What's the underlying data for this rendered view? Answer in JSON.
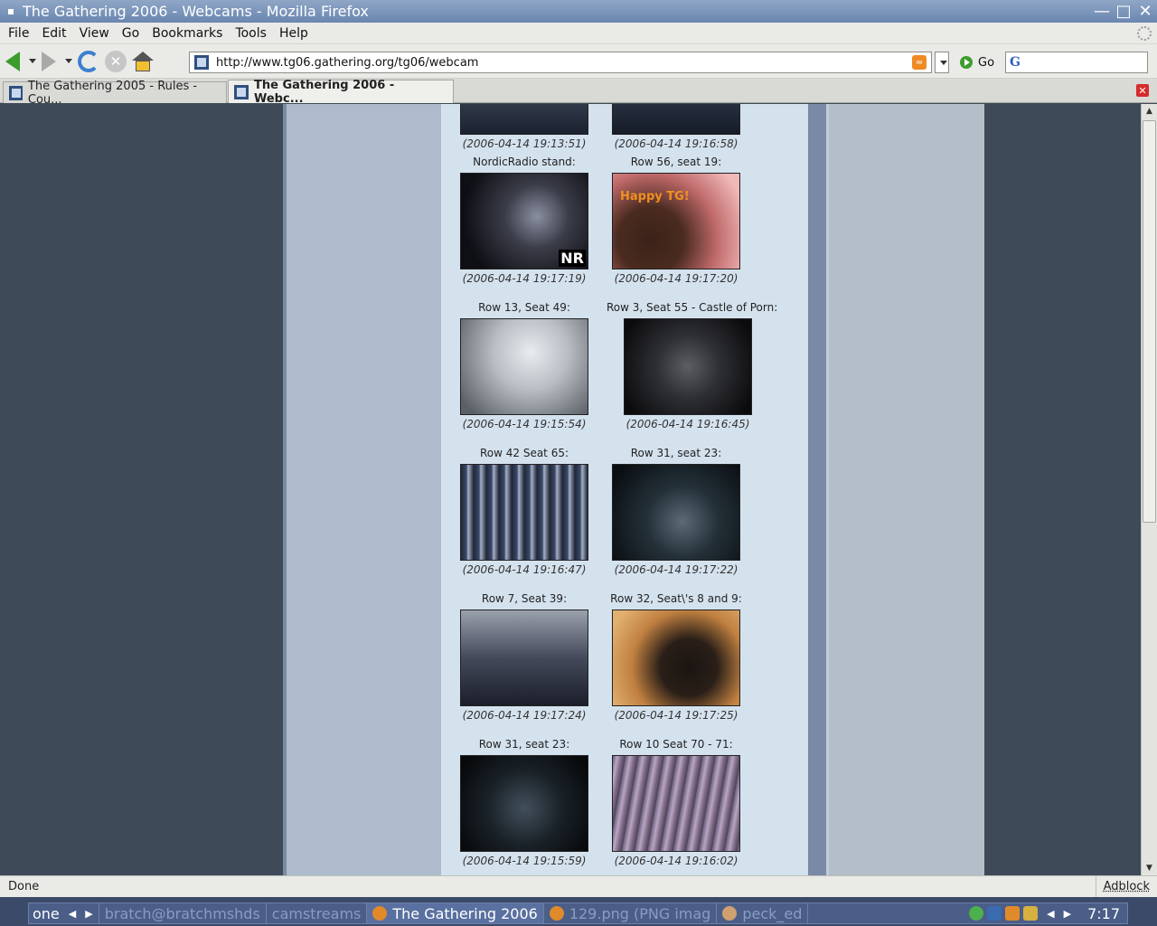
{
  "window": {
    "title": "The Gathering 2006 - Webcams - Mozilla Firefox"
  },
  "menu": [
    "File",
    "Edit",
    "View",
    "Go",
    "Bookmarks",
    "Tools",
    "Help"
  ],
  "navbar": {
    "url": "http://www.tg06.gathering.org/tg06/webcam",
    "go_label": "Go"
  },
  "tabs": [
    {
      "label": "The Gathering 2005 - Rules - Cou...",
      "active": false
    },
    {
      "label": "The Gathering 2006 - Webc...",
      "active": true
    }
  ],
  "cams_top": [
    {
      "timestamp": "(2006-04-14 19:13:51)"
    },
    {
      "timestamp": "(2006-04-14 19:16:58)"
    }
  ],
  "cams": [
    {
      "caption": "NordicRadio stand:",
      "timestamp": "(2006-04-14 19:17:19)",
      "overlay": "NR"
    },
    {
      "caption": "Row 56, seat 19:",
      "timestamp": "(2006-04-14 19:17:20)",
      "overlay": "Happy TG!"
    },
    {
      "caption": "Row 13, Seat 49:",
      "timestamp": "(2006-04-14 19:15:54)"
    },
    {
      "caption": "Row 3, Seat 55 - Castle of Porn:",
      "timestamp": "(2006-04-14 19:16:45)"
    },
    {
      "caption": "Row 42 Seat 65:",
      "timestamp": "(2006-04-14 19:16:47)"
    },
    {
      "caption": "Row 31, seat 23:",
      "timestamp": "(2006-04-14 19:17:22)"
    },
    {
      "caption": "Row 7, Seat 39:",
      "timestamp": "(2006-04-14 19:17:24)"
    },
    {
      "caption": "Row 32, Seat\\'s 8 and 9:",
      "timestamp": "(2006-04-14 19:17:25)"
    },
    {
      "caption": "Row 31, seat 23:",
      "timestamp": "(2006-04-14 19:15:59)"
    },
    {
      "caption": "Row 10 Seat 70 - 71:",
      "timestamp": "(2006-04-14 19:16:02)"
    }
  ],
  "statusbar": {
    "status": "Done",
    "adblock": "Adblock"
  },
  "taskbar": {
    "workspace": "one",
    "items": [
      {
        "label": "bratch@bratchmshds",
        "active": false
      },
      {
        "label": "camstreams",
        "active": false
      },
      {
        "label": "The Gathering 2006",
        "active": true
      },
      {
        "label": "129.png (PNG imag",
        "active": false
      },
      {
        "label": "peck_ed",
        "active": false
      }
    ],
    "clock": "7:17"
  },
  "colors": {
    "page_main": "#d4e2ee",
    "page_side": "#aebbcc",
    "page_bg": "#3f4a58",
    "titlebar": "#6a86b0"
  }
}
